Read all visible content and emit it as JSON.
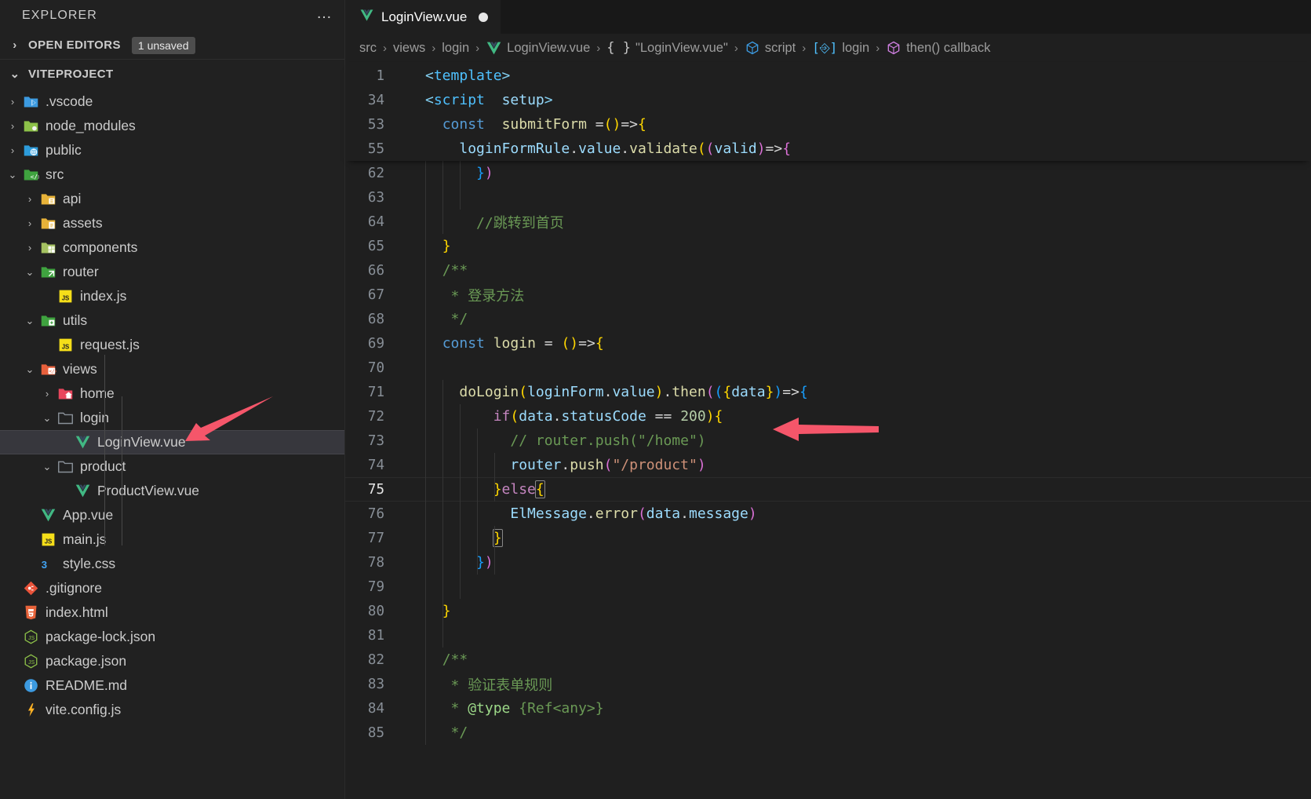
{
  "sidebar": {
    "title": "EXPLORER",
    "more_actions": "…",
    "open_editors": {
      "label": "OPEN EDITORS",
      "badge": "1 unsaved",
      "twisty": "›"
    },
    "project": {
      "label": "VITEPROJECT",
      "twisty": "⌄"
    },
    "tree": [
      {
        "label": ".vscode",
        "indent": 1,
        "arrow": "›",
        "icon": "folder-vscode-icon",
        "type": "folder"
      },
      {
        "label": "node_modules",
        "indent": 1,
        "arrow": "›",
        "icon": "folder-node-icon",
        "type": "folder"
      },
      {
        "label": "public",
        "indent": 1,
        "arrow": "›",
        "icon": "folder-public-icon",
        "type": "folder"
      },
      {
        "label": "src",
        "indent": 1,
        "arrow": "⌄",
        "icon": "folder-src-icon",
        "type": "folder"
      },
      {
        "label": "api",
        "indent": 2,
        "arrow": "›",
        "icon": "folder-api-icon",
        "type": "folder"
      },
      {
        "label": "assets",
        "indent": 2,
        "arrow": "›",
        "icon": "folder-assets-icon",
        "type": "folder"
      },
      {
        "label": "components",
        "indent": 2,
        "arrow": "›",
        "icon": "folder-components-icon",
        "type": "folder"
      },
      {
        "label": "router",
        "indent": 2,
        "arrow": "⌄",
        "icon": "folder-router-icon",
        "type": "folder"
      },
      {
        "label": "index.js",
        "indent": 3,
        "arrow": "",
        "icon": "js-file-icon",
        "type": "file"
      },
      {
        "label": "utils",
        "indent": 2,
        "arrow": "⌄",
        "icon": "folder-utils-icon",
        "type": "folder"
      },
      {
        "label": "request.js",
        "indent": 3,
        "arrow": "",
        "icon": "js-file-icon",
        "type": "file"
      },
      {
        "label": "views",
        "indent": 2,
        "arrow": "⌄",
        "icon": "folder-views-icon",
        "type": "folder"
      },
      {
        "label": "home",
        "indent": 3,
        "arrow": "›",
        "icon": "folder-home-icon",
        "type": "folder"
      },
      {
        "label": "login",
        "indent": 3,
        "arrow": "⌄",
        "icon": "folder-icon",
        "type": "folder"
      },
      {
        "label": "LoginView.vue",
        "indent": 4,
        "arrow": "",
        "icon": "vue-file-icon",
        "type": "file",
        "selected": true
      },
      {
        "label": "product",
        "indent": 3,
        "arrow": "⌄",
        "icon": "folder-icon",
        "type": "folder"
      },
      {
        "label": "ProductView.vue",
        "indent": 4,
        "arrow": "",
        "icon": "vue-file-icon",
        "type": "file"
      },
      {
        "label": "App.vue",
        "indent": 2,
        "arrow": "",
        "icon": "vue-file-icon",
        "type": "file"
      },
      {
        "label": "main.js",
        "indent": 2,
        "arrow": "",
        "icon": "js-file-icon",
        "type": "file"
      },
      {
        "label": "style.css",
        "indent": 2,
        "arrow": "",
        "icon": "css-file-icon",
        "type": "file"
      },
      {
        "label": ".gitignore",
        "indent": 1,
        "arrow": "",
        "icon": "git-file-icon",
        "type": "file"
      },
      {
        "label": "index.html",
        "indent": 1,
        "arrow": "",
        "icon": "html-file-icon",
        "type": "file"
      },
      {
        "label": "package-lock.json",
        "indent": 1,
        "arrow": "",
        "icon": "npm-file-icon",
        "type": "file"
      },
      {
        "label": "package.json",
        "indent": 1,
        "arrow": "",
        "icon": "npm-file-icon",
        "type": "file"
      },
      {
        "label": "README.md",
        "indent": 1,
        "arrow": "",
        "icon": "readme-file-icon",
        "type": "file"
      },
      {
        "label": "vite.config.js",
        "indent": 1,
        "arrow": "",
        "icon": "vite-file-icon",
        "type": "file"
      }
    ]
  },
  "editor": {
    "tab": {
      "label": "LoginView.vue",
      "icon": "vue-file-icon",
      "dirty": true
    },
    "breadcrumbs": [
      {
        "label": "src",
        "icon": ""
      },
      {
        "label": "views",
        "icon": ""
      },
      {
        "label": "login",
        "icon": ""
      },
      {
        "label": "LoginView.vue",
        "icon": "vue-file-icon"
      },
      {
        "label": "\"LoginView.vue\"",
        "icon": "braces-icon"
      },
      {
        "label": "script",
        "icon": "module-icon"
      },
      {
        "label": "login",
        "icon": "variable-icon"
      },
      {
        "label": "then() callback",
        "icon": "function-cube-icon"
      }
    ],
    "breadcrumb_separator": "›",
    "sticky_lines": [
      {
        "num": "1",
        "html": "<span class=\"t-tag\">&lt;</span><span class=\"t-tagname\">template</span><span class=\"t-tag\">&gt;</span>"
      },
      {
        "num": "34",
        "html": "<span class=\"t-tag\">&lt;</span><span class=\"t-tagname\">script</span>  <span class=\"t-var\">setup</span><span class=\"t-tag\">&gt;</span>"
      },
      {
        "num": "53",
        "html": "  <span class=\"t-kw\">const</span>  <span class=\"t-fn\">submitForm</span> <span class=\"t-op\">=</span><span class=\"t-pr1\">(</span><span class=\"t-pr1\">)</span><span class=\"t-op\">=&gt;</span><span class=\"t-pr1\">{</span>"
      },
      {
        "num": "55",
        "html": "    <span class=\"t-var\">loginFormRule</span><span class=\"t-white\">.</span><span class=\"t-prop\">value</span><span class=\"t-white\">.</span><span class=\"t-fn\">validate</span><span class=\"t-pr1\">(</span><span class=\"t-pr2\">(</span><span class=\"t-var\">valid</span><span class=\"t-pr2\">)</span><span class=\"t-op\">=&gt;</span><span class=\"t-pr2\">{</span>"
      }
    ],
    "lines": [
      {
        "num": "62",
        "indent": 2,
        "html": "      <span class=\"t-pr3\">}</span><span class=\"t-pr2\">)</span>"
      },
      {
        "num": "63",
        "indent": 2,
        "html": ""
      },
      {
        "num": "64",
        "indent": 2,
        "html": "      <span class=\"t-com\">//跳转到首页</span>"
      },
      {
        "num": "65",
        "indent": 1,
        "html": "  <span class=\"t-pr1\">}</span>"
      },
      {
        "num": "66",
        "indent": 1,
        "html": "  <span class=\"t-com\">/**</span>"
      },
      {
        "num": "67",
        "indent": 1,
        "html": "   <span class=\"t-com\">* 登录方法</span>"
      },
      {
        "num": "68",
        "indent": 1,
        "html": "   <span class=\"t-com\">*/</span>"
      },
      {
        "num": "69",
        "indent": 1,
        "html": "  <span class=\"t-kw\">const</span> <span class=\"t-fn\">login</span> <span class=\"t-op\">=</span> <span class=\"t-pr1\">(</span><span class=\"t-pr1\">)</span><span class=\"t-op\">=&gt;</span><span class=\"t-pr1\">{</span>"
      },
      {
        "num": "70",
        "indent": 1,
        "html": ""
      },
      {
        "num": "71",
        "indent": 2,
        "html": "    <span class=\"t-fn\">doLogin</span><span class=\"t-pr1\">(</span><span class=\"t-var\">loginForm</span><span class=\"t-white\">.</span><span class=\"t-prop\">value</span><span class=\"t-pr1\">)</span><span class=\"t-white\">.</span><span class=\"t-fn\">then</span><span class=\"t-pr2\">(</span><span class=\"t-pr3\">(</span><span class=\"t-pr1\">{</span><span class=\"t-var\">data</span><span class=\"t-pr1\">}</span><span class=\"t-pr3\">)</span><span class=\"t-op\">=&gt;</span><span class=\"t-pr3\">{</span>"
      },
      {
        "num": "72",
        "indent": 3,
        "html": "        <span class=\"t-kw2\">if</span><span class=\"t-pr1\">(</span><span class=\"t-var\">data</span><span class=\"t-white\">.</span><span class=\"t-prop\">statusCode</span> <span class=\"t-op\">==</span> <span class=\"t-num\">200</span><span class=\"t-pr1\">)</span><span class=\"t-pr1\">{</span>"
      },
      {
        "num": "73",
        "indent": 4,
        "html": "          <span class=\"t-com\">// router.push(\"/home\")</span>"
      },
      {
        "num": "74",
        "indent": 4,
        "html": "          <span class=\"t-var\">router</span><span class=\"t-white\">.</span><span class=\"t-fn\">push</span><span class=\"t-pr2\">(</span><span class=\"t-str\">\"/product\"</span><span class=\"t-pr2\">)</span>"
      },
      {
        "num": "75",
        "indent": 3,
        "html": "        <span class=\"t-pr1\">}</span><span class=\"t-kw2\">else</span><span class=\"t-pr1 bracket-match\">{</span>",
        "current": true
      },
      {
        "num": "76",
        "indent": 4,
        "html": "          <span class=\"t-var\">ElMessage</span><span class=\"t-white\">.</span><span class=\"t-fn\">error</span><span class=\"t-pr2\">(</span><span class=\"t-var\">data</span><span class=\"t-white\">.</span><span class=\"t-prop\">message</span><span class=\"t-pr2\">)</span>"
      },
      {
        "num": "77",
        "indent": 3,
        "html": "        <span class=\"t-pr1 bracket-match\">}</span>"
      },
      {
        "num": "78",
        "indent": 2,
        "html": "      <span class=\"t-pr3\">}</span><span class=\"t-pr2\">)</span>"
      },
      {
        "num": "79",
        "indent": 2,
        "html": ""
      },
      {
        "num": "80",
        "indent": 1,
        "html": "  <span class=\"t-pr1\">}</span>"
      },
      {
        "num": "81",
        "indent": 1,
        "html": ""
      },
      {
        "num": "82",
        "indent": 1,
        "html": "  <span class=\"t-com\">/**</span>"
      },
      {
        "num": "83",
        "indent": 1,
        "html": "   <span class=\"t-com\">* 验证表单规则</span>"
      },
      {
        "num": "84",
        "indent": 1,
        "html": "   <span class=\"t-com\">* </span><span class=\"t-docpar\">@type</span><span class=\"t-com\"> {Ref&lt;any&gt;}</span>"
      },
      {
        "num": "85",
        "indent": 1,
        "html": "   <span class=\"t-com\">*/</span>"
      }
    ]
  },
  "annotations": {
    "arrow_color": "#f5566a",
    "arrows": [
      {
        "name": "arrow-pointing-to-loginview-file",
        "target": "LoginView.vue"
      },
      {
        "name": "arrow-pointing-to-router-push",
        "target": "router.push(\"/product\")"
      }
    ]
  }
}
